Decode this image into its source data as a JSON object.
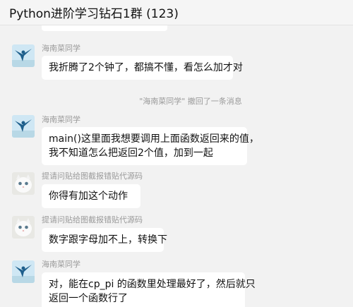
{
  "header": {
    "title": "Python进阶学习钻石1群 (123)"
  },
  "messages": [
    {
      "sender": "海南菜同学",
      "avatar": "blue-figure-avatar",
      "lines": [
        "我折腾了2个钟了，都搞不懂，看怎么加才对"
      ]
    },
    {
      "system": "\"海南菜同学\" 撤回了一条消息"
    },
    {
      "sender": "海南菜同学",
      "avatar": "blue-figure-avatar",
      "lines": [
        "main()这里面我想要调用上面函数返回来的值，",
        "我不知道怎么把返回2个值，加到一起"
      ]
    },
    {
      "sender": "提请问贴给图截报错贴代源码",
      "avatar": "white-cat-avatar",
      "lines": [
        "你得有加这个动作"
      ]
    },
    {
      "sender": "提请问贴给图截报错贴代源码",
      "avatar": "white-cat-avatar",
      "lines": [
        "数字跟字母加不上，转换下"
      ]
    },
    {
      "sender": "海南菜同学",
      "avatar": "blue-figure-avatar",
      "lines": [
        "对，能在cp_pi 的函数里处理最好了，然后就只",
        "返回一个函数行了"
      ]
    }
  ]
}
